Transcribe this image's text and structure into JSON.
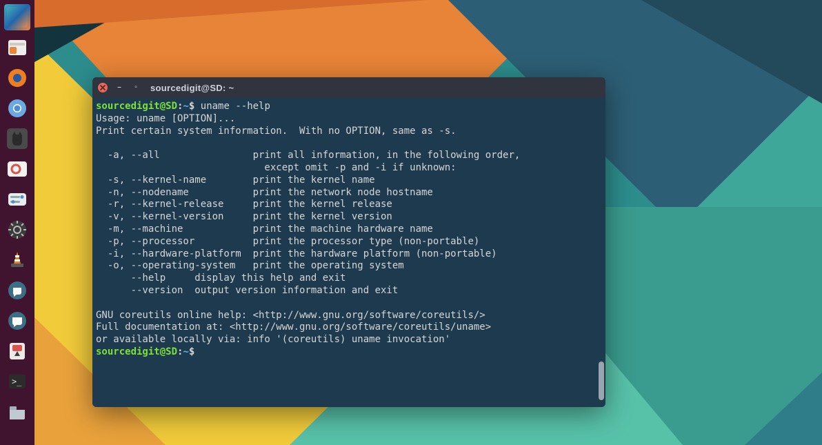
{
  "window": {
    "title": "sourcedigit@SD: ~"
  },
  "prompt": {
    "user_host": "sourcedigit@SD",
    "path": "~",
    "sep": ":",
    "sigil": "$"
  },
  "terminal": {
    "command1": "uname --help",
    "output": "Usage: uname [OPTION]...\nPrint certain system information.  With no OPTION, same as -s.\n\n  -a, --all                print all information, in the following order,\n                             except omit -p and -i if unknown:\n  -s, --kernel-name        print the kernel name\n  -n, --nodename           print the network node hostname\n  -r, --kernel-release     print the kernel release\n  -v, --kernel-version     print the kernel version\n  -m, --machine            print the machine hardware name\n  -p, --processor          print the processor type (non-portable)\n  -i, --hardware-platform  print the hardware platform (non-portable)\n  -o, --operating-system   print the operating system\n      --help     display this help and exit\n      --version  output version information and exit\n\nGNU coreutils online help: <http://www.gnu.org/software/coreutils/>\nFull documentation at: <http://www.gnu.org/software/coreutils/uname>\nor available locally via: info '(coreutils) uname invocation'"
  },
  "dock": {
    "items": [
      {
        "id": "show-desktop",
        "name": "show-desktop-icon"
      },
      {
        "id": "files",
        "name": "files-icon"
      },
      {
        "id": "firefox",
        "name": "firefox-icon"
      },
      {
        "id": "chromium",
        "name": "chromium-icon"
      },
      {
        "id": "cat-app",
        "name": "cat-icon"
      },
      {
        "id": "screenshot",
        "name": "screenshot-icon"
      },
      {
        "id": "tweaks",
        "name": "tweaks-icon"
      },
      {
        "id": "settings",
        "name": "settings-icon"
      },
      {
        "id": "vlc",
        "name": "vlc-icon"
      },
      {
        "id": "chat1",
        "name": "chat-icon"
      },
      {
        "id": "chat2",
        "name": "chat2-icon"
      },
      {
        "id": "transmission",
        "name": "transmission-icon"
      },
      {
        "id": "terminal",
        "name": "terminal-icon"
      },
      {
        "id": "folder",
        "name": "folder-icon"
      }
    ]
  }
}
